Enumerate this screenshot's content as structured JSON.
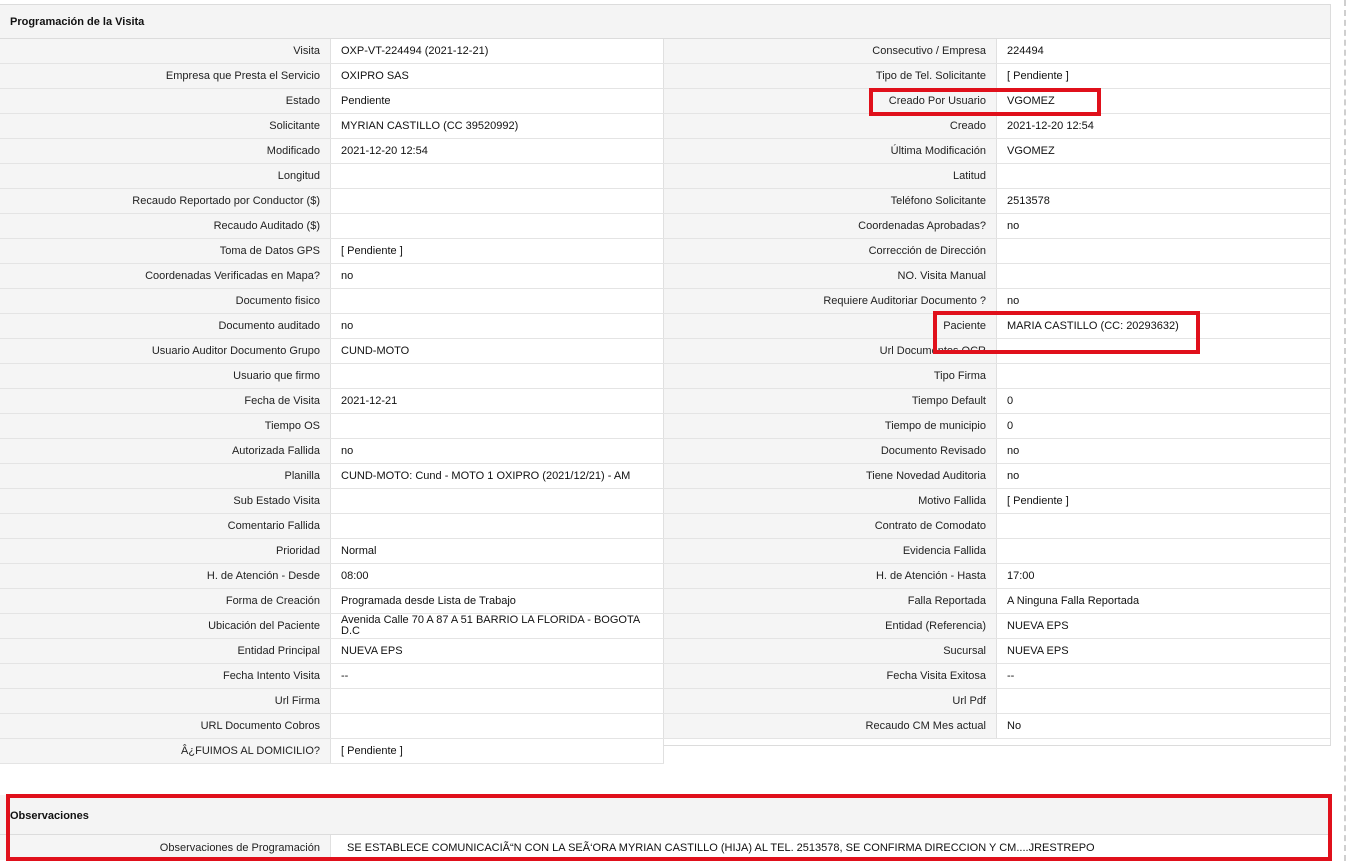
{
  "panel": {
    "title": "Programación de la Visita"
  },
  "left": [
    {
      "label": "Visita",
      "value": "OXP-VT-224494 (2021-12-21)"
    },
    {
      "label": "Empresa que Presta el Servicio",
      "value": "OXIPRO SAS"
    },
    {
      "label": "Estado",
      "value": "Pendiente"
    },
    {
      "label": "Solicitante",
      "value": "MYRIAN CASTILLO (CC 39520992)"
    },
    {
      "label": "Modificado",
      "value": "2021-12-20 12:54"
    },
    {
      "label": "Longitud",
      "value": ""
    },
    {
      "label": "Recaudo Reportado por Conductor ($)",
      "value": ""
    },
    {
      "label": "Recaudo Auditado ($)",
      "value": ""
    },
    {
      "label": "Toma de Datos GPS",
      "value": "[ Pendiente ]"
    },
    {
      "label": "Coordenadas Verificadas en Mapa?",
      "value": " no"
    },
    {
      "label": "Documento fisico",
      "value": ""
    },
    {
      "label": "Documento auditado",
      "value": " no"
    },
    {
      "label": "Usuario Auditor Documento Grupo",
      "value": "CUND-MOTO"
    },
    {
      "label": "Usuario que firmo",
      "value": ""
    },
    {
      "label": "Fecha de Visita",
      "value": " 2021-12-21"
    },
    {
      "label": "Tiempo OS",
      "value": ""
    },
    {
      "label": "Autorizada Fallida",
      "value": " no"
    },
    {
      "label": "Planilla",
      "value": "CUND-MOTO: Cund - MOTO 1 OXIPRO (2021/12/21) - AM"
    },
    {
      "label": "Sub Estado Visita",
      "value": ""
    },
    {
      "label": "Comentario Fallida",
      "value": ""
    },
    {
      "label": "Prioridad",
      "value": "Normal"
    },
    {
      "label": "H. de Atención - Desde",
      "value": "08:00"
    },
    {
      "label": "Forma de Creación",
      "value": "Programada desde Lista de Trabajo"
    },
    {
      "label": "Ubicación del Paciente",
      "value": "Avenida Calle 70 A 87 A 51 BARRIO LA FLORIDA - BOGOTA D.C",
      "wrap": true
    },
    {
      "label": "Entidad Principal",
      "value": "NUEVA EPS"
    },
    {
      "label": "Fecha Intento Visita",
      "value": " --"
    },
    {
      "label": "Url Firma",
      "value": ""
    },
    {
      "label": "URL Documento Cobros",
      "value": ""
    },
    {
      "label": "Â¿FUIMOS AL DOMICILIO?",
      "value": "[ Pendiente ]"
    }
  ],
  "right": [
    {
      "label": "Consecutivo / Empresa",
      "value": "224494"
    },
    {
      "label": "Tipo de Tel. Solicitante",
      "value": "[ Pendiente ]"
    },
    {
      "label": "Creado Por Usuario",
      "value": "VGOMEZ"
    },
    {
      "label": "Creado",
      "value": "2021-12-20 12:54"
    },
    {
      "label": "Última Modificación",
      "value": " VGOMEZ"
    },
    {
      "label": "Latitud",
      "value": ""
    },
    {
      "label": "Teléfono Solicitante",
      "value": "2513578"
    },
    {
      "label": "Coordenadas Aprobadas?",
      "value": " no"
    },
    {
      "label": "Corrección de Dirección",
      "value": ""
    },
    {
      "label": "NO. Visita Manual",
      "value": ""
    },
    {
      "label": "Requiere Auditoriar Documento ?",
      "value": " no"
    },
    {
      "label": "Paciente",
      "value": "MARIA CASTILLO (CC: 20293632)"
    },
    {
      "label": "Url Documentos OCR",
      "value": ""
    },
    {
      "label": "Tipo Firma",
      "value": ""
    },
    {
      "label": "Tiempo Default",
      "value": "0"
    },
    {
      "label": "Tiempo de municipio",
      "value": "0"
    },
    {
      "label": "Documento Revisado",
      "value": " no"
    },
    {
      "label": "Tiene Novedad Auditoria",
      "value": " no"
    },
    {
      "label": "Motivo Fallida",
      "value": "[ Pendiente ]"
    },
    {
      "label": "Contrato de Comodato",
      "value": ""
    },
    {
      "label": "Evidencia Fallida",
      "value": ""
    },
    {
      "label": "H. de Atención - Hasta",
      "value": "17:00"
    },
    {
      "label": "Falla Reportada",
      "value": "A Ninguna Falla Reportada"
    },
    {
      "label": "Entidad (Referencia)",
      "value": "NUEVA EPS"
    },
    {
      "label": "Sucursal",
      "value": "NUEVA EPS"
    },
    {
      "label": "Fecha Visita Exitosa",
      "value": " --"
    },
    {
      "label": "Url Pdf",
      "value": ""
    },
    {
      "label": "Recaudo CM Mes actual",
      "value": "No"
    }
  ],
  "observations": {
    "title": "Observaciones",
    "label": "Observaciones de Programación",
    "value": "SE ESTABLECE COMUNICACIÃ“N CON LA SEÃ‘ORA MYRIAN CASTILLO (HIJA) AL TEL. 2513578, SE CONFIRMA DIRECCION Y CM....JRESTREPO"
  },
  "colors": {
    "highlight": "#e0101b",
    "label_bg": "#f5f5f5"
  }
}
